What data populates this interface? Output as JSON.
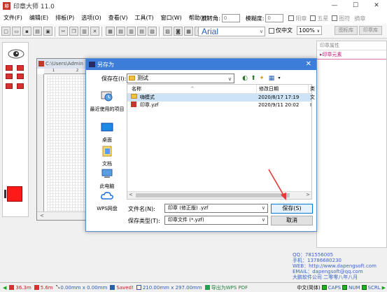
{
  "app": {
    "title": "印章大师 11.0",
    "window_controls": [
      "—",
      "☐",
      "✕"
    ]
  },
  "menubar": {
    "items": [
      "文件(F)",
      "编辑(E)",
      "排板(P)",
      "选项(O)",
      "查看(V)",
      "工具(T)",
      "窗口(W)",
      "帮助(H)"
    ],
    "rotation_label": "旋转角:",
    "rotation_value": "0",
    "blur_label": "模糊度:",
    "blur_value": "0",
    "yang_label": "阳章",
    "star_label": "五星",
    "graphic_label": "图符",
    "info_label": "摘章"
  },
  "toolbar": {
    "font": "Arial",
    "cjk_only_label": "仅中文",
    "zoom": "100%",
    "tab_seal_bank": "图标库",
    "tab_seal_lib": "印章库"
  },
  "document": {
    "title": "C:\\Users\\Admin",
    "ruler_marks": [
      "1",
      "2"
    ],
    "scroll_left": "<"
  },
  "right_panel": {
    "title": "印章属性",
    "section": "▸印章元素"
  },
  "dialog": {
    "title": "另存为",
    "save_in_label": "保存在(I):",
    "save_in_value": "测试",
    "places": [
      {
        "label": "最近使用的项目"
      },
      {
        "label": "桌面"
      },
      {
        "label": "文档"
      },
      {
        "label": "此电脑"
      },
      {
        "label": "WPS网盘"
      }
    ],
    "columns": {
      "name": "名称",
      "modified": "修改日期",
      "extra": "类"
    },
    "files": [
      {
        "name": "嗨模式",
        "modified": "2020/8/17 17:19",
        "extra": "文"
      },
      {
        "name": "印章.yzf",
        "modified": "2020/9/11 20:02",
        "extra": "I"
      }
    ],
    "filename_label": "文件名(N):",
    "filename_value": "印章 (修正版) .yzf",
    "filetype_label": "保存类型(T):",
    "filetype_value": "印章文件 (*.yzf)",
    "save_button": "保存(S)",
    "cancel_button": "取消"
  },
  "contact": {
    "qq": "QQ：781556005",
    "phone": "手机：13786680230",
    "web": "WEB：http://www.dapengsoft.com",
    "email": "EMAIL：dapengsoft@qq.com",
    "company": "大鹏软件公司 二零零八年八月"
  },
  "statusbar": {
    "pos1": "36.3m",
    "pos2": "5.6m",
    "size": "0.00mm x 0.00mm",
    "saved": "Saved!",
    "paper": "210.00mm x 297.00mm",
    "export": "导出为WPS PDF",
    "lang": "中文(简体)",
    "caps": "CAPS",
    "num": "NUM",
    "scrl": "SCRL"
  },
  "colors": {
    "title_blue": "#3b7dd8",
    "accent_red": "#d93030",
    "contact_blue": "#3b66c8"
  }
}
